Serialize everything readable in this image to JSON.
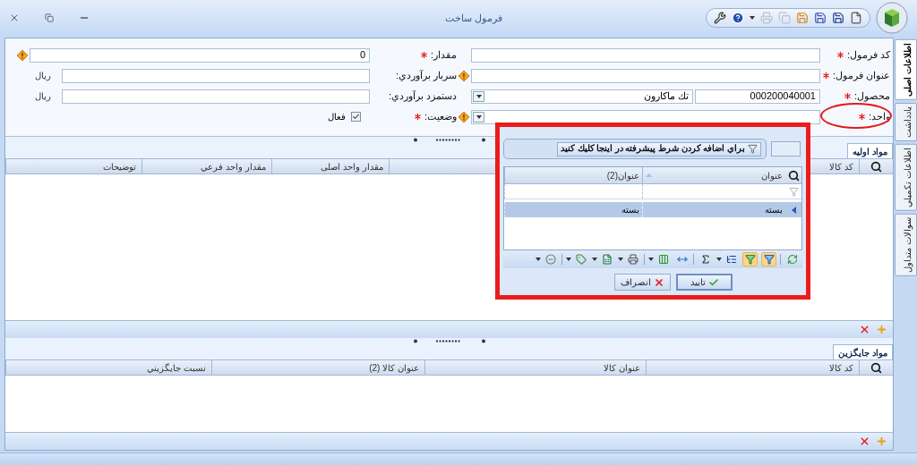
{
  "window": {
    "title": "فرمول ساخت"
  },
  "quick_access": [
    {
      "kind": "new",
      "disabled": false
    },
    {
      "kind": "save",
      "disabled": false
    },
    {
      "kind": "save-as",
      "disabled": false
    },
    {
      "kind": "save-close",
      "disabled": false
    },
    {
      "kind": "copy",
      "disabled": true
    },
    {
      "kind": "print",
      "disabled": true
    },
    {
      "kind": "menu",
      "disabled": false
    },
    {
      "kind": "help",
      "disabled": false
    },
    {
      "kind": "tools",
      "disabled": false
    }
  ],
  "side_tabs": [
    {
      "label": "اطلاعات اصلی",
      "selected": true
    },
    {
      "label": "يادداشت",
      "selected": false
    },
    {
      "label": "اطلاعات تكميلي",
      "selected": false
    },
    {
      "label": "سوالات متداول",
      "selected": false
    }
  ],
  "form": {
    "right_column": [
      {
        "kind": "text",
        "label": "كد فرمول:",
        "required": true,
        "warning": false,
        "highlighted": false
      },
      {
        "kind": "text",
        "label": "عنوان فرمول:",
        "required": true,
        "warning": true,
        "highlighted": false
      },
      {
        "kind": "product",
        "label": "محصول:",
        "required": true,
        "warning": false,
        "highlighted": false,
        "code": "000200040001",
        "value": "تك ماكارون"
      },
      {
        "kind": "select",
        "label": "واحد:",
        "required": true,
        "warning": true,
        "highlighted": true
      }
    ],
    "left_column": [
      {
        "kind": "text",
        "label": "مقدار:",
        "required": true,
        "warning": true,
        "highlighted": false,
        "value": "0"
      },
      {
        "kind": "text",
        "label": "سربار برآوردي:",
        "required": false,
        "warning": false,
        "highlighted": false,
        "unit": "ريال"
      },
      {
        "kind": "text",
        "label": "دستمزد برآوردي:",
        "required": false,
        "warning": false,
        "highlighted": false,
        "unit": "ريال"
      },
      {
        "kind": "checkbox",
        "label": "وضعيت:",
        "required": true,
        "warning": false,
        "highlighted": false,
        "checked": true,
        "option": "فعال"
      }
    ]
  },
  "materials": {
    "tab": "مواد اوليه",
    "columns": [
      "كد كالا",
      "مقدار واحد اصلی",
      "مقدار واحد فرعي",
      "توضيحات"
    ]
  },
  "substitutes": {
    "tab": "مواد جايگزين",
    "columns": [
      "كد كالا",
      "عنوان كالا",
      "عنوان كالا (2)",
      "نسبت جايگزيني"
    ]
  },
  "popup": {
    "filter_prompt": "براي اضافه كردن شرط پيشرفته در اينجا كليك كنيد",
    "columns": [
      {
        "label": "عنوان",
        "sorted": true
      },
      {
        "label": "عنوان(2)",
        "sorted": false
      }
    ],
    "rows": [
      {
        "cells": [
          "بسته",
          "بسته"
        ],
        "selected": true
      }
    ],
    "toolbar": [
      {
        "items": [
          {
            "kind": "refresh",
            "on": false,
            "has_menu": false
          }
        ]
      },
      {
        "items": [
          {
            "kind": "filter",
            "on": true,
            "has_menu": false
          },
          {
            "kind": "filter-row",
            "on": true,
            "has_menu": false
          },
          {
            "kind": "group",
            "on": false,
            "has_menu": true
          },
          {
            "kind": "sum",
            "on": false,
            "has_menu": false
          }
        ]
      },
      {
        "items": [
          {
            "kind": "fit",
            "on": false,
            "has_menu": false
          },
          {
            "kind": "columns",
            "on": false,
            "has_menu": true
          }
        ]
      },
      {
        "items": [
          {
            "kind": "print",
            "on": false,
            "has_menu": true
          },
          {
            "kind": "excel",
            "on": false,
            "has_menu": true
          },
          {
            "kind": "export",
            "on": false,
            "has_menu": true
          }
        ]
      },
      {
        "items": [
          {
            "kind": "collapse",
            "on": false,
            "has_menu": true
          }
        ]
      }
    ],
    "buttons": [
      {
        "kind": "confirm",
        "label": "تاييد",
        "default": true
      },
      {
        "kind": "cancel",
        "label": "انصراف",
        "default": false
      }
    ]
  }
}
